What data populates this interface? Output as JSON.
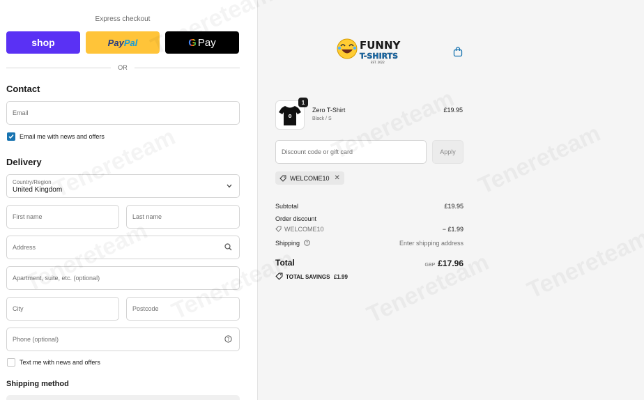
{
  "express": {
    "title": "Express checkout",
    "shop_label": "shop",
    "paypal_part1": "Pay",
    "paypal_part2": "Pal",
    "gpay_label": "Pay",
    "or_label": "OR"
  },
  "contact": {
    "heading": "Contact",
    "email_placeholder": "Email",
    "news_label": "Email me with news and offers",
    "news_checked": true
  },
  "delivery": {
    "heading": "Delivery",
    "country_label": "Country/Region",
    "country_value": "United Kingdom",
    "first_name": "First name",
    "last_name": "Last name",
    "address": "Address",
    "apartment": "Apartment, suite, etc. (optional)",
    "city": "City",
    "postcode": "Postcode",
    "phone": "Phone (optional)",
    "text_news_label": "Text me with news and offers",
    "text_news_checked": false
  },
  "shipping_method": {
    "heading": "Shipping method"
  },
  "brand": {
    "line1": "FUNNY",
    "line2": "T-SHIRTS",
    "est": "EST. 2022"
  },
  "cart": {
    "items": [
      {
        "quantity": "1",
        "name": "Zero T-Shirt",
        "variant": "Black / S",
        "price": "£19.95",
        "print": "0"
      }
    ]
  },
  "discount": {
    "placeholder": "Discount code or gift card",
    "apply_label": "Apply",
    "applied_code": "WELCOME10"
  },
  "summary": {
    "subtotal_label": "Subtotal",
    "subtotal_value": "£19.95",
    "order_discount_label": "Order discount",
    "discount_code": "WELCOME10",
    "discount_value": "− £1.99",
    "shipping_label": "Shipping",
    "shipping_value": "Enter shipping address",
    "total_label": "Total",
    "total_currency": "GBP",
    "total_value": "£17.96",
    "savings_label": "TOTAL SAVINGS",
    "savings_value": "£1.99"
  },
  "watermark": "Tenereteam",
  "colors": {
    "shop": "#5a31f4",
    "paypal": "#ffc439",
    "gpay": "#000000",
    "checkbox": "#1773b0",
    "right_bg": "#f5f5f5"
  }
}
